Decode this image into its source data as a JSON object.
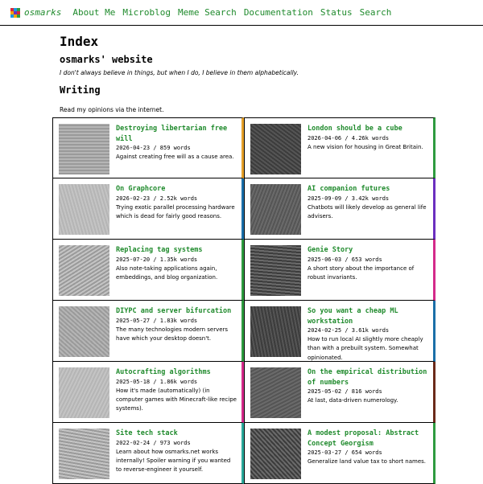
{
  "nav": {
    "brand": "osmarks",
    "links": [
      "About Me",
      "Microblog",
      "Meme Search",
      "Documentation",
      "Status",
      "Search"
    ],
    "logo_colors": [
      "#d7263d",
      "#1b98e0",
      "#2e9b3f",
      "#f4a300",
      "#6b2fbf",
      "#d7263d",
      "#1b98e0",
      "#f4a300",
      "#2e9b3f"
    ]
  },
  "header": {
    "title": "Index",
    "subtitle": "osmarks' website",
    "tagline": "I don't always believe in things, but when I do, I believe in them alphabetically."
  },
  "writing": {
    "heading": "Writing",
    "intro": "Read my opinions via the internet."
  },
  "colors": {
    "accent": "#1f8a2c"
  },
  "posts": [
    {
      "title": "Destroying libertarian free will",
      "meta": "2026-04-23 / 859 words",
      "desc": "Against creating free will as a cause area.",
      "stripe": "#e6a12a",
      "thumb": "dice-thumbnail"
    },
    {
      "title": "London should be a cube",
      "meta": "2026-04-06 / 4.26k words",
      "desc": "A new vision for housing in Great Britain.",
      "stripe": "#2e9b3f",
      "thumb": "cube-city-thumbnail"
    },
    {
      "title": "On Graphcore",
      "meta": "2026-02-23 / 2.52k words",
      "desc": "Trying exotic parallel processing hardware which is dead for fairly good reasons.",
      "stripe": "#1b6fa8",
      "thumb": "chip-thumbnail"
    },
    {
      "title": "AI companion futures",
      "meta": "2025-09-09 / 3.42k words",
      "desc": "Chatbots will likely develop as general life advisers.",
      "stripe": "#6b2fbf",
      "thumb": "portrait-thumbnail"
    },
    {
      "title": "Replacing tag systems",
      "meta": "2025-07-20 / 1.35k words",
      "desc": "Also note-taking applications again, embeddings, and blog organization.",
      "stripe": "#2e9b3f",
      "thumb": "book-thumbnail"
    },
    {
      "title": "Genie Story",
      "meta": "2025-06-03 / 653 words",
      "desc": "A short story about the importance of robust invariants.",
      "stripe": "#d42a8a",
      "thumb": "genie-thumbnail"
    },
    {
      "title": "DIYPC and server bifurcation",
      "meta": "2025-05-27 / 1.83k words",
      "desc": "The many technologies modern servers have which your desktop doesn't.",
      "stripe": "#2e9b3f",
      "thumb": "server-rack-thumbnail"
    },
    {
      "title": "So you want a cheap ML workstation",
      "meta": "2024-02-25 / 3.61k words",
      "desc": "How to run local AI slightly more cheaply than with a prebuilt system. Somewhat opinionated.",
      "stripe": "#1b6fa8",
      "thumb": "workstation-thumbnail"
    },
    {
      "title": "Autocrafting algorithms",
      "meta": "2025-05-18 / 1.86k words",
      "desc": "How it's made (automatically) (in computer games with Minecraft-like recipe systems).",
      "stripe": "#d42a8a",
      "thumb": "factory-thumbnail"
    },
    {
      "title": "On the empirical distribution of numbers",
      "meta": "2025-05-02 / 816 words",
      "desc": "At last, data-driven numerology.",
      "stripe": "#6b2a1a",
      "thumb": "papers-thumbnail"
    },
    {
      "title": "Site tech stack",
      "meta": "2022-02-24 / 973 words",
      "desc": "Learn about how osmarks.net works internally! Spoiler warning if you wanted to reverse-engineer it yourself.",
      "stripe": "#2aa89a",
      "thumb": "tower-thumbnail"
    },
    {
      "title": "A modest proposal: Abstract Concept Georgism",
      "meta": "2025-03-27 / 654 words",
      "desc": "Generalize land value tax to short names.",
      "stripe": "#2e9b3f",
      "thumb": "globe-thumbnail"
    }
  ]
}
